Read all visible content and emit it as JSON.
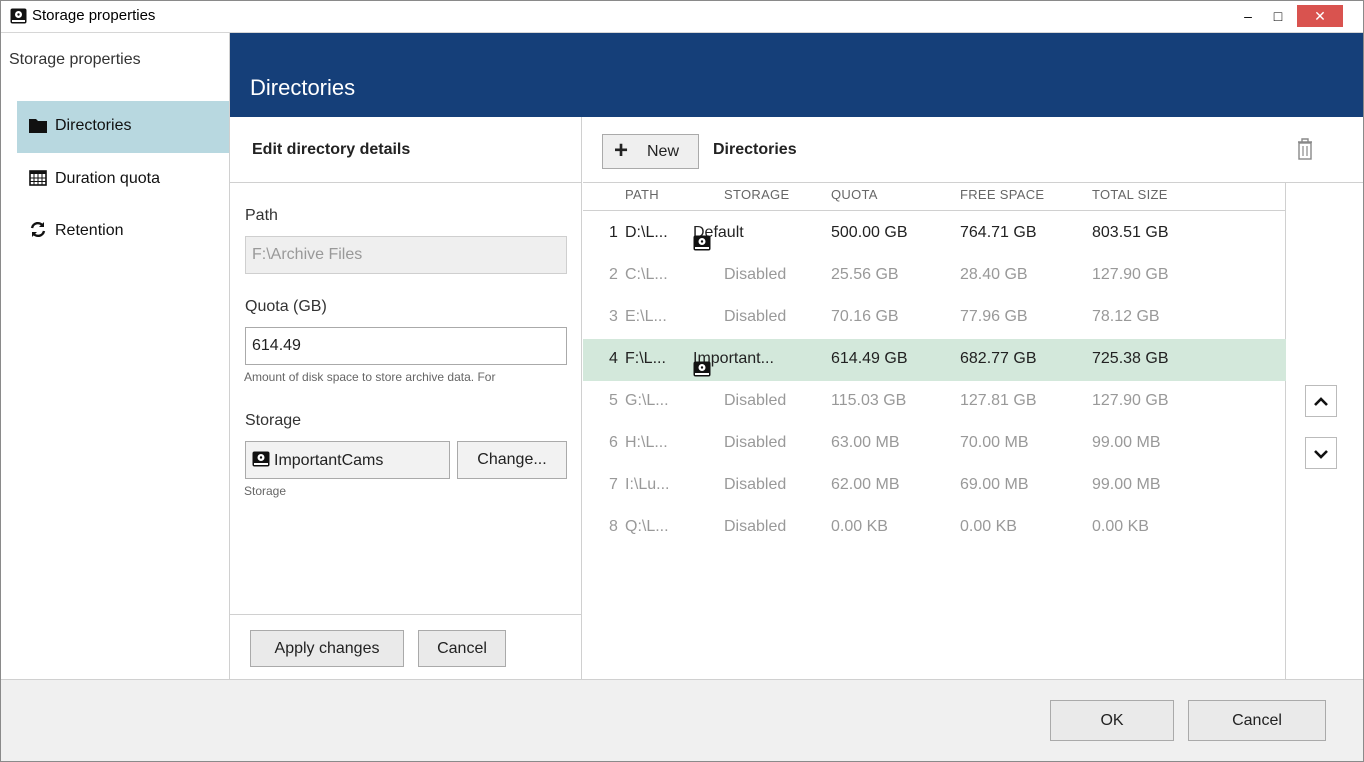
{
  "window": {
    "title": "Storage properties",
    "minimize": "–",
    "maximize": "□",
    "close": "✕"
  },
  "nav": {
    "header": "Storage properties",
    "items": [
      {
        "label": "Directories",
        "icon": "folder-icon",
        "active": true
      },
      {
        "label": "Duration quota",
        "icon": "calendar-icon",
        "active": false
      },
      {
        "label": "Retention",
        "icon": "refresh-icon",
        "active": false
      }
    ]
  },
  "banner": {
    "title": "Directories"
  },
  "edit": {
    "header": "Edit directory details",
    "path_label": "Path",
    "path_value": "F:\\Archive Files",
    "quota_label": "Quota (GB)",
    "quota_value": "614.49",
    "quota_hint": "Amount of disk space to store archive data. For",
    "storage_label": "Storage",
    "storage_value": "ImportantCams",
    "change_button": "Change...",
    "storage_hint": "Storage",
    "apply_button": "Apply changes",
    "cancel_button": "Cancel"
  },
  "list": {
    "new_button": "New",
    "title": "Directories",
    "columns": {
      "path": "PATH",
      "storage": "STORAGE",
      "quota": "QUOTA",
      "free": "FREE SPACE",
      "total": "TOTAL SIZE"
    },
    "rows": [
      {
        "num": "1",
        "path": "D:\\L...",
        "storage": "Default",
        "quota": "500.00 GB",
        "free": "764.71 GB",
        "total": "803.51 GB",
        "enabled": true,
        "selected": false
      },
      {
        "num": "2",
        "path": "C:\\L...",
        "storage": "Disabled",
        "quota": "25.56 GB",
        "free": "28.40 GB",
        "total": "127.90 GB",
        "enabled": false,
        "selected": false
      },
      {
        "num": "3",
        "path": "E:\\L...",
        "storage": "Disabled",
        "quota": "70.16 GB",
        "free": "77.96 GB",
        "total": "78.12 GB",
        "enabled": false,
        "selected": false
      },
      {
        "num": "4",
        "path": "F:\\L...",
        "storage": "Important...",
        "quota": "614.49 GB",
        "free": "682.77 GB",
        "total": "725.38 GB",
        "enabled": true,
        "selected": true
      },
      {
        "num": "5",
        "path": "G:\\L...",
        "storage": "Disabled",
        "quota": "115.03 GB",
        "free": "127.81 GB",
        "total": "127.90 GB",
        "enabled": false,
        "selected": false
      },
      {
        "num": "6",
        "path": "H:\\L...",
        "storage": "Disabled",
        "quota": "63.00 MB",
        "free": "70.00 MB",
        "total": "99.00 MB",
        "enabled": false,
        "selected": false
      },
      {
        "num": "7",
        "path": "I:\\Lu...",
        "storage": "Disabled",
        "quota": "62.00 MB",
        "free": "69.00 MB",
        "total": "99.00 MB",
        "enabled": false,
        "selected": false
      },
      {
        "num": "8",
        "path": "Q:\\L...",
        "storage": "Disabled",
        "quota": "0.00 KB",
        "free": "0.00 KB",
        "total": "0.00 KB",
        "enabled": false,
        "selected": false
      }
    ]
  },
  "footer": {
    "ok_button": "OK",
    "cancel_button": "Cancel"
  },
  "colors": {
    "banner": "#153f79",
    "nav_active": "#b8d8e0",
    "row_selected": "#d3e8db",
    "close_button": "#d9534f"
  }
}
